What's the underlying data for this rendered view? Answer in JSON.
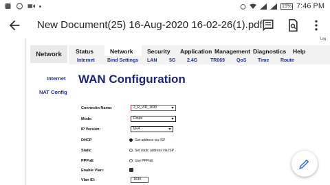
{
  "status_bar": {
    "battery": "15%",
    "time": "7:46 PM"
  },
  "app_bar": {
    "title": "New Document(25) 16-Aug-2020 16-02-26(1).pdf"
  },
  "router": {
    "corner_text": "Log",
    "section_tab": "Network",
    "main_nav": [
      "Status",
      "Network",
      "Security",
      "Application",
      "Management",
      "Diagnostics",
      "Help"
    ],
    "sub_nav": [
      "Internet",
      "Bind Settings",
      "LAN",
      "5G",
      "2.4G",
      "TR069",
      "QoS",
      "Time",
      "Route"
    ],
    "side_links": [
      "Internet",
      "NAT Config"
    ],
    "page_title": "WAN Configuration",
    "form": {
      "connection_name_label": "Connectin Name:",
      "connection_name_value": "2_R_VID_1630",
      "mode_label": "Mode:",
      "mode_value": "Route",
      "ip_version_label": "IP Version:",
      "ip_version_value": "Ipv4",
      "dhcp_label": "DHCP",
      "dhcp_option": "Get address via ISP",
      "static_label": "Static",
      "static_option": "Set static address via ISP",
      "pppoe_label": "PPPoE",
      "pppoe_option": "Use PPPoE",
      "enable_vlan_label": "Enable Vlan:",
      "vlan_id_label": "Vlan ID:",
      "vlan_id_value": "1630"
    }
  },
  "icons": [
    "back-arrow-icon",
    "comment-icon",
    "search-doc-icon",
    "more-vert-icon",
    "edit-pencil-icon"
  ]
}
